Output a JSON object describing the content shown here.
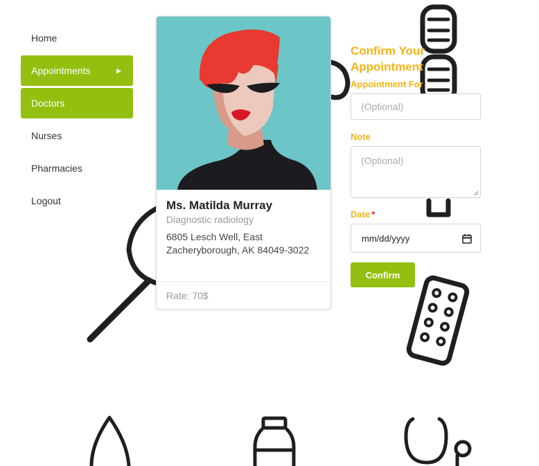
{
  "sidebar": {
    "items": [
      {
        "label": "Home",
        "active": false
      },
      {
        "label": "Appointments",
        "active": true,
        "has_caret": true
      },
      {
        "label": "Doctors",
        "active": true
      },
      {
        "label": "Nurses",
        "active": false
      },
      {
        "label": "Pharmacies",
        "active": false
      },
      {
        "label": "Logout",
        "active": false
      }
    ]
  },
  "doctor": {
    "name": "Ms. Matilda Murray",
    "specialty": "Diagnostic radiology",
    "address": "6805 Lesch Well, East Zacheryborough, AK 84049-3022",
    "rate": "Rate: 70$"
  },
  "form": {
    "title": "Confirm Your Appointment",
    "appointment_for_label": "Appointment For",
    "appointment_for_placeholder": "(Optional)",
    "note_label": "Note",
    "note_placeholder": "(Optional)",
    "date_label": "Date",
    "date_required": "*",
    "date_placeholder": "mm/dd/yyyy",
    "confirm_label": "Confirm"
  },
  "colors": {
    "accent_green": "#93bf10",
    "accent_orange": "#f5b315",
    "required_red": "#e01b1b",
    "photo_bg": "#6cc5c7"
  },
  "icons": [
    "caret-right-icon",
    "calendar-icon",
    "chain-icon",
    "magnifier-icon",
    "pill-pack-icon",
    "droplet-icon",
    "medicine-bottle-icon",
    "stethoscope-icon"
  ]
}
